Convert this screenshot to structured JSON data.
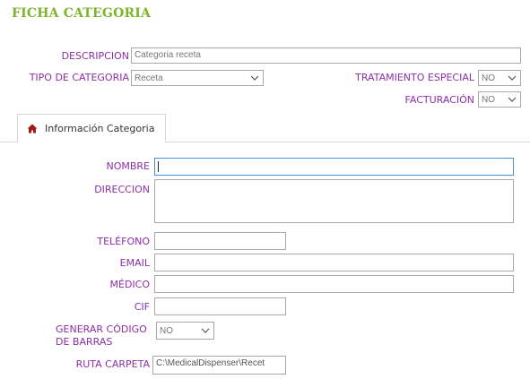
{
  "header": {
    "title": "FICHA CATEGORIA"
  },
  "top_form": {
    "descripcion_label": "DESCRIPCION",
    "descripcion_value": "Categoria receta",
    "tipo_label": "TIPO DE CATEGORIA",
    "tipo_value": "Receta",
    "tratamiento_label": "TRATAMIENTO ESPECIAL",
    "tratamiento_value": "NO",
    "facturacion_label": "FACTURACIÓN",
    "facturacion_value": "NO"
  },
  "tabs": [
    {
      "label": "Información Categoria",
      "icon": "home-icon",
      "active": true
    }
  ],
  "category_form": {
    "nombre_label": "NOMBRE",
    "nombre_value": "",
    "direccion_label": "DIRECCION",
    "direccion_value": "",
    "telefono_label": "TELÉFONO",
    "telefono_value": "",
    "email_label": "EMAIL",
    "email_value": "",
    "medico_label": "MÉDICO",
    "medico_value": "",
    "cif_label": "CIF",
    "cif_value": "",
    "barcode_label_line1": "GENERAR CÓDIGO",
    "barcode_label_line2": "DE BARRAS",
    "barcode_value": "NO",
    "ruta_label": "RUTA CARPETA",
    "ruta_value": "C:\\MedicalDispenser\\Recet"
  },
  "colors": {
    "title": "#7cb52a",
    "label": "#8b2fa6",
    "focus_border": "#4a90d6",
    "home_icon": "#a11a1a"
  }
}
